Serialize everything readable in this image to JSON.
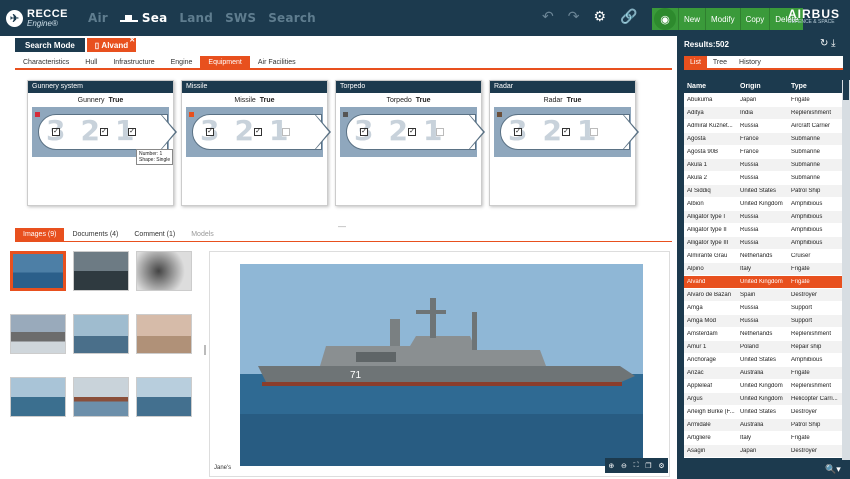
{
  "brand": {
    "line1": "RECCE",
    "line2": "Engine®"
  },
  "nav": {
    "air": "Air",
    "sea": "Sea",
    "land": "Land",
    "sws": "SWS",
    "search": "Search"
  },
  "toolbar": {
    "new": "New",
    "modify": "Modify",
    "copy": "Copy",
    "delete": "Delete"
  },
  "airbus": {
    "name": "AIRBUS",
    "sub": "DEFENCE & SPACE"
  },
  "mode": {
    "search_mode": "Search Mode",
    "ship": "Alvand"
  },
  "tabs": [
    "Characteristics",
    "Hull",
    "Infrastructure",
    "Engine",
    "Equipment",
    "Air Facilities"
  ],
  "cards": [
    {
      "title": "Gunnery system",
      "label": "Gunnery",
      "value": "True",
      "color": "#d62b3a"
    },
    {
      "title": "Missile",
      "label": "Missile",
      "value": "True",
      "color": "#e8501e"
    },
    {
      "title": "Torpedo",
      "label": "Torpedo",
      "value": "True",
      "color": "#555555"
    },
    {
      "title": "Radar",
      "label": "Radar",
      "value": "True",
      "color": "#6b4f3a"
    }
  ],
  "digits": [
    "3",
    "2",
    "1"
  ],
  "tooltip": {
    "line1": "Number: 1",
    "line2": "Shape: Single"
  },
  "media_tabs": [
    "Images (9)",
    "Documents (4)",
    "Comment (1)",
    "Models"
  ],
  "photo_credit": "Jane's",
  "results": {
    "title": "Results:502",
    "tabs": [
      "List",
      "Tree",
      "History"
    ],
    "columns": [
      "Name",
      "Origin",
      "Type"
    ]
  },
  "rows": [
    [
      "Abukuma",
      "Japan",
      "Frigate"
    ],
    [
      "Aditya",
      "India",
      "Replenishment"
    ],
    [
      "Admiral Kuznet...",
      "Russia",
      "Aircraft Carrier"
    ],
    [
      "Agosta",
      "France",
      "Submarine"
    ],
    [
      "Agosta 90B",
      "France",
      "Submarine"
    ],
    [
      "Akula 1",
      "Russia",
      "Submarine"
    ],
    [
      "Akula 2",
      "Russia",
      "Submarine"
    ],
    [
      "Al Siddiq",
      "United States",
      "Patrol Ship"
    ],
    [
      "Albion",
      "United Kingdom",
      "Amphibious"
    ],
    [
      "Alligator type I",
      "Russia",
      "Amphibious"
    ],
    [
      "Alligator type II",
      "Russia",
      "Amphibious"
    ],
    [
      "Alligator type III",
      "Russia",
      "Amphibious"
    ],
    [
      "Almirante Grau",
      "Netherlands",
      "Cruiser"
    ],
    [
      "Alpino",
      "Italy",
      "Frigate"
    ],
    [
      "Alvand",
      "United Kingdom",
      "Frigate"
    ],
    [
      "Alvaro de Bazan",
      "Spain",
      "Destroyer"
    ],
    [
      "Amga",
      "Russia",
      "Support"
    ],
    [
      "Amga Mod",
      "Russia",
      "Support"
    ],
    [
      "Amsterdam",
      "Netherlands",
      "Replenishment"
    ],
    [
      "Amur 1",
      "Poland",
      "Repair ship"
    ],
    [
      "Anchorage",
      "United States",
      "Amphibious"
    ],
    [
      "Anzac",
      "Australia",
      "Frigate"
    ],
    [
      "Appleleaf",
      "United Kingdom",
      "Replenishment"
    ],
    [
      "Argus",
      "United Kingdom",
      "Helicopter Carri..."
    ],
    [
      "Arleigh Burke (F...",
      "United States",
      "Destroyer"
    ],
    [
      "Armidale",
      "Australia",
      "Patrol Ship"
    ],
    [
      "Artigliere",
      "Italy",
      "Frigate"
    ],
    [
      "Asagiri",
      "Japan",
      "Destroyer"
    ]
  ],
  "selected_row": "Alvand"
}
